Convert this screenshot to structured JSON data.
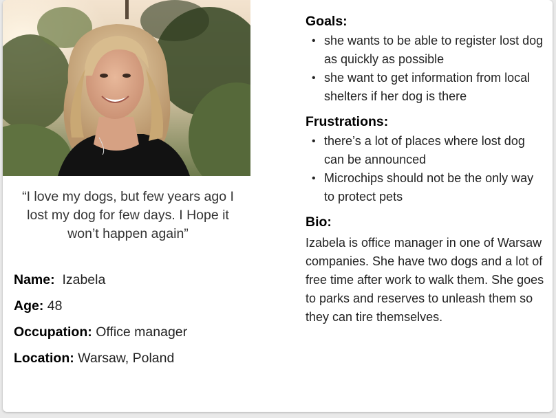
{
  "quote": "“I love my dogs, but few years ago I lost my dog for few days. I Hope it won’t happen again”",
  "profile": {
    "name_label": "Name:",
    "name_value": "Izabela",
    "age_label": "Age:",
    "age_value": "48",
    "occupation_label": "Occupation:",
    "occupation_value": "Office manager",
    "location_label": "Location:",
    "location_value": "Warsaw, Poland"
  },
  "goals": {
    "title": "Goals:",
    "items": [
      "she wants to be able to register lost dog as quickly as possible",
      "she want to get information from local shelters if her dog is there"
    ]
  },
  "frustrations": {
    "title": "Frustrations:",
    "items": [
      "there’s a lot of places where lost dog can be announced",
      "Microchips should not be the only way to protect pets"
    ]
  },
  "bio": {
    "title": "Bio:",
    "text": "Izabela is office manager in one of Warsaw companies. She have two dogs and a lot of free time after work to walk them. She goes to parks and reserves to unleash them so they can tire themselves."
  },
  "colors": {
    "card_bg": "#ffffff",
    "page_bg": "#e9e9e9",
    "text": "#222222"
  }
}
